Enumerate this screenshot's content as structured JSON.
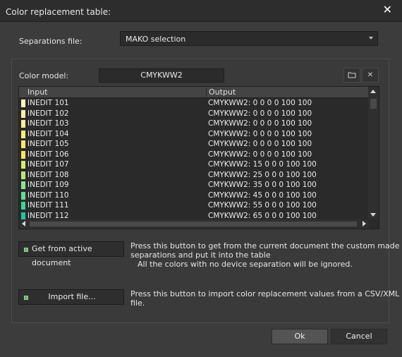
{
  "window": {
    "title": "Color replacement table:",
    "close_glyph": "✕"
  },
  "separations": {
    "label": "Separations file:",
    "value": "MAKO selection"
  },
  "color_model": {
    "label": "Color model:",
    "value": "CMYKWW2"
  },
  "table": {
    "headers": [
      "Input",
      "Output"
    ],
    "rows": [
      {
        "input": "INEDIT 101",
        "output": "CMYKWW2:  0 0 0 0 100 100",
        "color": "#fff5b8"
      },
      {
        "input": "INEDIT 102",
        "output": "CMYKWW2:  0 0 0 0 100 100",
        "color": "#fff3a0"
      },
      {
        "input": "INEDIT 103",
        "output": "CMYKWW2:  0 0 0 0 100 100",
        "color": "#ffef8c"
      },
      {
        "input": "INEDIT 104",
        "output": "CMYKWW2:  0 0 0 0 100 100",
        "color": "#ffec78"
      },
      {
        "input": "INEDIT 105",
        "output": "CMYKWW2:  0 0 0 0 100 100",
        "color": "#fde868"
      },
      {
        "input": "INEDIT 106",
        "output": "CMYKWW2:  0 0 0 0 100 100",
        "color": "#f5e85a"
      },
      {
        "input": "INEDIT 107",
        "output": "CMYKWW2:  15 0 0 0 100 100",
        "color": "#d8ea6a"
      },
      {
        "input": "INEDIT 108",
        "output": "CMYKWW2:  25 0 0 0 100 100",
        "color": "#b4e87a"
      },
      {
        "input": "INEDIT 109",
        "output": "CMYKWW2:  35 0 0 0 100 100",
        "color": "#8ce48a"
      },
      {
        "input": "INEDIT 110",
        "output": "CMYKWW2:  45 0 0 0 100 100",
        "color": "#5edf8c"
      },
      {
        "input": "INEDIT 111",
        "output": "CMYKWW2:  55 0 0 0 100 100",
        "color": "#36d894"
      },
      {
        "input": "INEDIT 112",
        "output": "CMYKWW2:  65 0 0 0 100 100",
        "color": "#1ac9a0"
      }
    ]
  },
  "get_active": {
    "button_label": "Get from active document",
    "desc_line1": "Press this button to get from the current document the custom made",
    "desc_line2": "separations and put it into the table",
    "desc_line3": "All the colors with no device separation will be ignored."
  },
  "import": {
    "button_label": "Import file...",
    "desc": "Press this button to import color replacement values from a CSV/XML file."
  },
  "footer": {
    "ok": "Ok",
    "cancel": "Cancel"
  },
  "icons": {
    "close": "close-icon",
    "folder": "folder-open-icon",
    "clear": "clear-x-icon",
    "dropdown": "chevron-down-icon",
    "status": "green-led-icon"
  }
}
